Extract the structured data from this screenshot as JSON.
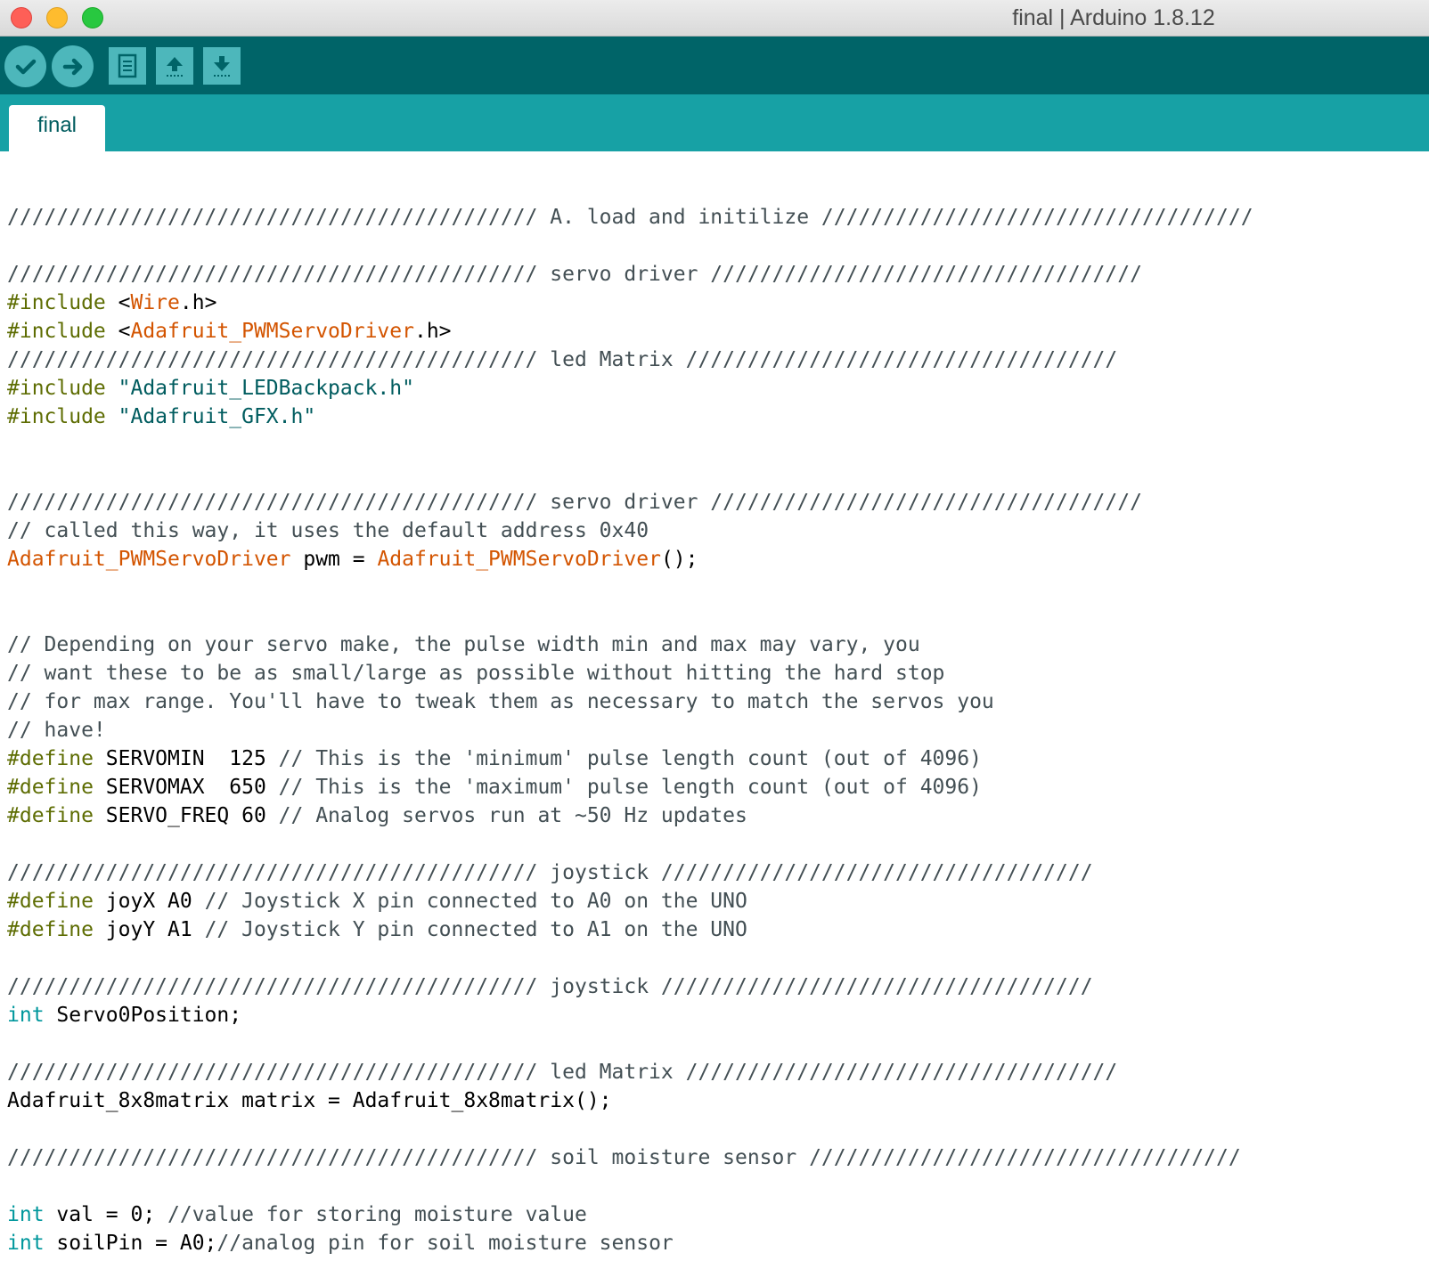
{
  "window": {
    "title": "final | Arduino 1.8.12"
  },
  "toolbar": {
    "buttons": [
      {
        "name": "verify-button",
        "icon": "checkmark-icon"
      },
      {
        "name": "upload-button",
        "icon": "arrow-right-icon"
      },
      {
        "name": "new-button",
        "icon": "document-icon"
      },
      {
        "name": "open-button",
        "icon": "arrow-up-icon"
      },
      {
        "name": "save-button",
        "icon": "arrow-down-icon"
      }
    ]
  },
  "tabs": [
    {
      "label": "final",
      "active": true
    }
  ],
  "colors": {
    "toolbar": "#006468",
    "tabstrip": "#17a1a5",
    "button": "#4db7bb",
    "comment": "#434f54",
    "preprocessor": "#5e6d03",
    "type": "#00979c",
    "library": "#d35400",
    "string": "#005c5f"
  },
  "editor": {
    "lines": [
      [
        [
          "comment",
          "/////////////////////////////////////////// A. load and initilize ///////////////////////////////////"
        ]
      ],
      [],
      [
        [
          "comment",
          "/////////////////////////////////////////// servo driver ///////////////////////////////////"
        ]
      ],
      [
        [
          "prep",
          "#include"
        ],
        [
          "plain",
          " <"
        ],
        [
          "lib",
          "Wire"
        ],
        [
          "plain",
          ".h>"
        ]
      ],
      [
        [
          "prep",
          "#include"
        ],
        [
          "plain",
          " <"
        ],
        [
          "lib",
          "Adafruit_PWMServoDriver"
        ],
        [
          "plain",
          ".h>"
        ]
      ],
      [
        [
          "comment",
          "/////////////////////////////////////////// led Matrix ///////////////////////////////////"
        ]
      ],
      [
        [
          "prep",
          "#include"
        ],
        [
          "plain",
          " "
        ],
        [
          "str",
          "\"Adafruit_LEDBackpack.h\""
        ]
      ],
      [
        [
          "prep",
          "#include"
        ],
        [
          "plain",
          " "
        ],
        [
          "str",
          "\"Adafruit_GFX.h\""
        ]
      ],
      [],
      [],
      [
        [
          "comment",
          "/////////////////////////////////////////// servo driver ///////////////////////////////////"
        ]
      ],
      [
        [
          "comment",
          "// called this way, it uses the default address 0x40"
        ]
      ],
      [
        [
          "lib",
          "Adafruit_PWMServoDriver"
        ],
        [
          "plain",
          " pwm = "
        ],
        [
          "lib",
          "Adafruit_PWMServoDriver"
        ],
        [
          "plain",
          "();"
        ]
      ],
      [],
      [],
      [
        [
          "comment",
          "// Depending on your servo make, the pulse width min and max may vary, you"
        ]
      ],
      [
        [
          "comment",
          "// want these to be as small/large as possible without hitting the hard stop"
        ]
      ],
      [
        [
          "comment",
          "// for max range. You'll have to tweak them as necessary to match the servos you"
        ]
      ],
      [
        [
          "comment",
          "// have!"
        ]
      ],
      [
        [
          "prep",
          "#define"
        ],
        [
          "plain",
          " SERVOMIN  125 "
        ],
        [
          "comment",
          "// This is the 'minimum' pulse length count (out of 4096)"
        ]
      ],
      [
        [
          "prep",
          "#define"
        ],
        [
          "plain",
          " SERVOMAX  650 "
        ],
        [
          "comment",
          "// This is the 'maximum' pulse length count (out of 4096)"
        ]
      ],
      [
        [
          "prep",
          "#define"
        ],
        [
          "plain",
          " SERVO_FREQ 60 "
        ],
        [
          "comment",
          "// Analog servos run at ~50 Hz updates"
        ]
      ],
      [],
      [
        [
          "comment",
          "/////////////////////////////////////////// joystick ///////////////////////////////////"
        ]
      ],
      [
        [
          "prep",
          "#define"
        ],
        [
          "plain",
          " joyX A0 "
        ],
        [
          "comment",
          "// Joystick X pin connected to A0 on the UNO"
        ]
      ],
      [
        [
          "prep",
          "#define"
        ],
        [
          "plain",
          " joyY A1 "
        ],
        [
          "comment",
          "// Joystick Y pin connected to A1 on the UNO"
        ]
      ],
      [],
      [
        [
          "comment",
          "/////////////////////////////////////////// joystick ///////////////////////////////////"
        ]
      ],
      [
        [
          "type",
          "int"
        ],
        [
          "plain",
          " Servo0Position;"
        ]
      ],
      [],
      [
        [
          "comment",
          "/////////////////////////////////////////// led Matrix ///////////////////////////////////"
        ]
      ],
      [
        [
          "plain",
          "Adafruit_8x8matrix matrix = Adafruit_8x8matrix();"
        ]
      ],
      [],
      [
        [
          "comment",
          "/////////////////////////////////////////// soil moisture sensor ///////////////////////////////////"
        ]
      ],
      [],
      [
        [
          "type",
          "int"
        ],
        [
          "plain",
          " val = 0; "
        ],
        [
          "comment",
          "//value for storing moisture value"
        ]
      ],
      [
        [
          "type",
          "int"
        ],
        [
          "plain",
          " soilPin = A0;"
        ],
        [
          "comment",
          "//analog pin for soil moisture sensor"
        ]
      ]
    ]
  }
}
